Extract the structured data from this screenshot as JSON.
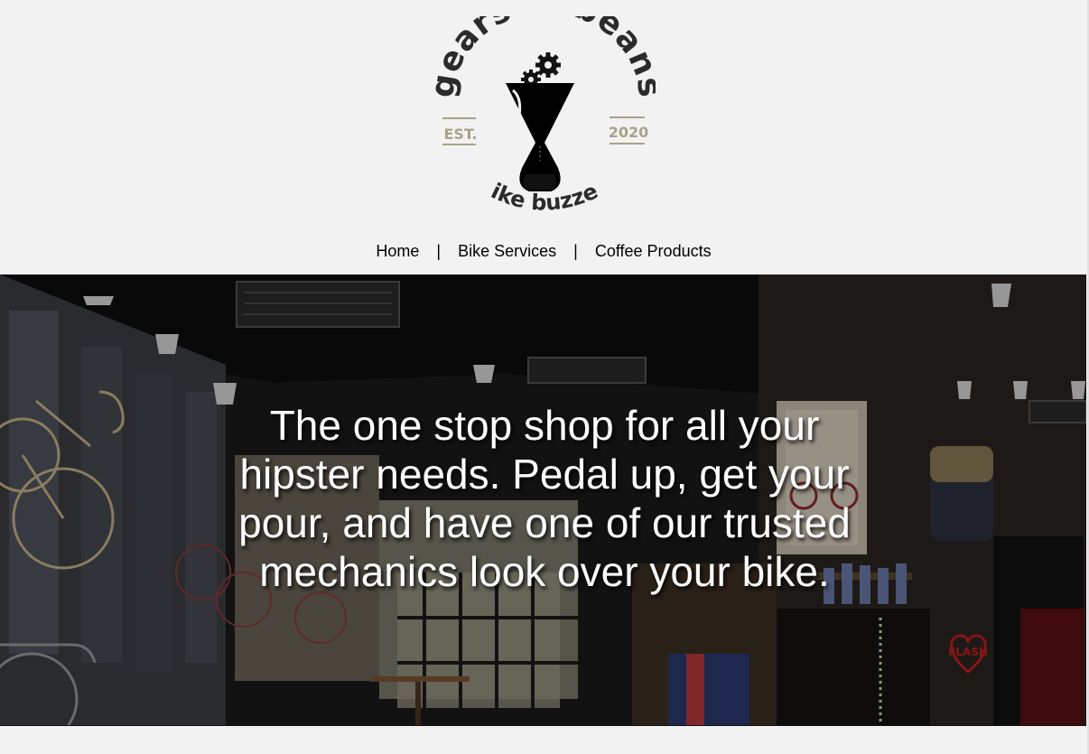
{
  "brand": {
    "name_arc": "gears n' beans",
    "established_label": "EST.",
    "established_year": "2020",
    "tagline": "bike buzzed"
  },
  "nav": {
    "items": [
      {
        "label": "Home"
      },
      {
        "label": "Bike Services"
      },
      {
        "label": "Coffee Products"
      }
    ],
    "separator": "|"
  },
  "hero": {
    "headline": "The one stop shop for all your hipster needs. Pedal up, get your pour, and have one of our trusted mechanics look over your bike.",
    "background_image": "bike-cafe-interior",
    "wall_sign": "FLASH"
  },
  "colors": {
    "page_bg": "#f2f2f2",
    "logo_dark": "#2b2b2b",
    "logo_accent": "#a8a48a",
    "hero_text": "#ffffff"
  }
}
